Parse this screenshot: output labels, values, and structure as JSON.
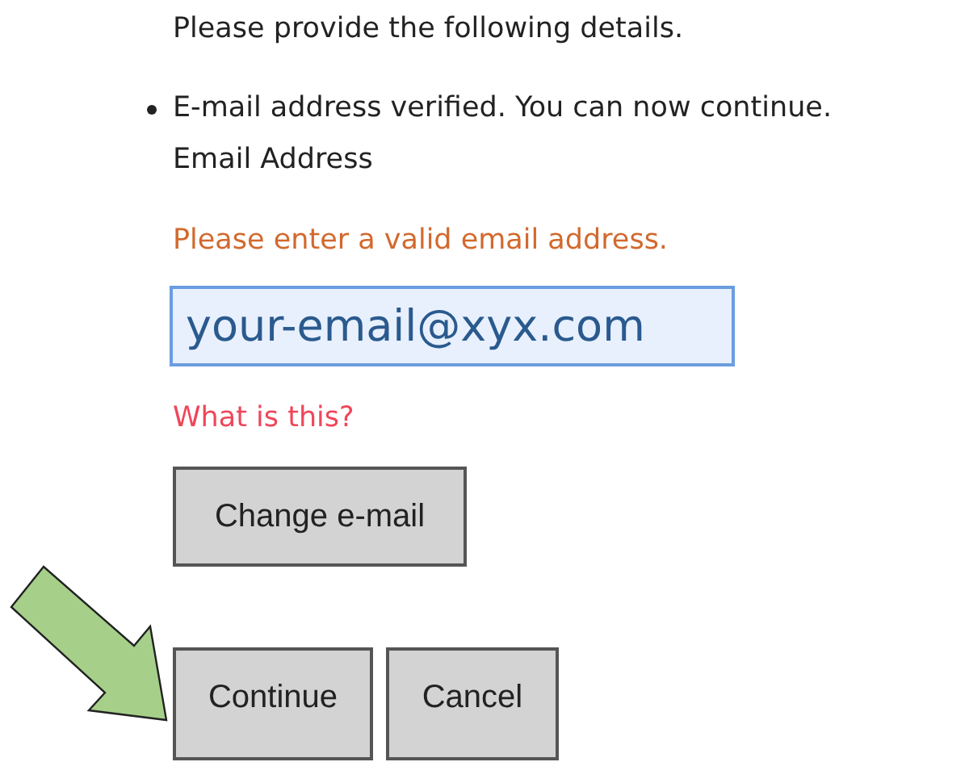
{
  "intro": "Please provide the following details.",
  "messages": [
    "E-mail address verified. You can now continue."
  ],
  "field": {
    "label": "Email Address",
    "error": "Please enter a valid email address.",
    "value": "your-email@xyx.com"
  },
  "help_link": "What is this?",
  "change_button": "Change e-mail",
  "buttons": [
    "Continue",
    "Cancel"
  ]
}
